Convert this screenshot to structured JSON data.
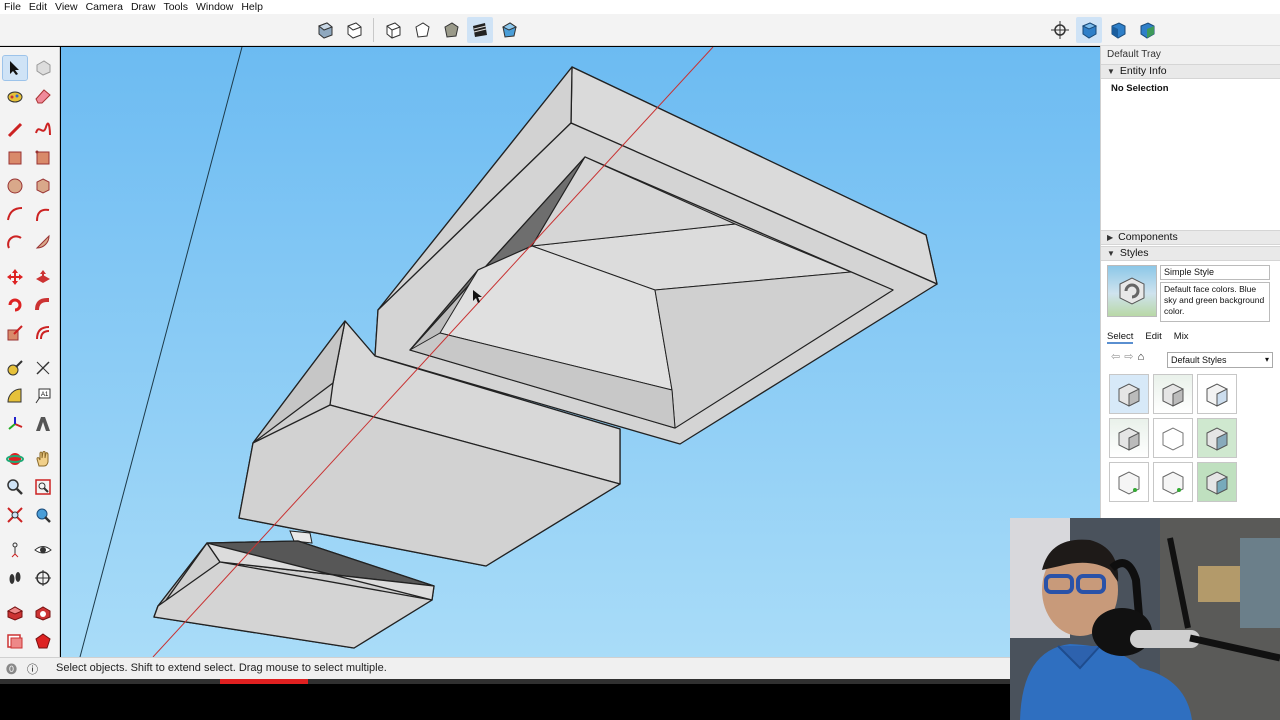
{
  "menu": [
    "File",
    "Edit",
    "View",
    "Camera",
    "Draw",
    "Tools",
    "Window",
    "Help"
  ],
  "toolbar": {
    "views": [
      "iso-view-icon",
      "top-view-icon",
      "front-view-icon",
      "right-view-icon",
      "back-view-icon",
      "left-view-icon"
    ],
    "styles": [
      "xray-icon",
      "wireframe-icon",
      "hidden-line-icon",
      "shaded-icon",
      "shaded-textures-icon",
      "monochrome-icon"
    ],
    "right": [
      "orbit-crosshair-icon",
      "standard-view-iso-icon",
      "standard-view-front-icon",
      "standard-view-right-icon"
    ]
  },
  "tray": {
    "title": "Default Tray",
    "entity_info": "Entity Info",
    "no_selection": "No Selection",
    "components": "Components",
    "styles": "Styles",
    "style_name": "Simple Style",
    "style_desc": "Default face colors. Blue sky and green background color.",
    "tab_select": "Select",
    "tab_edit": "Edit",
    "tab_mix": "Mix",
    "collection": "Default Styles"
  },
  "status": {
    "message": "Select objects. Shift to extend select. Drag mouse to select multiple."
  },
  "colors": {
    "sky": "#6fbdf2",
    "accent": "#5a8fd0",
    "face": "#d8d8d8",
    "progress": "#e02020"
  }
}
